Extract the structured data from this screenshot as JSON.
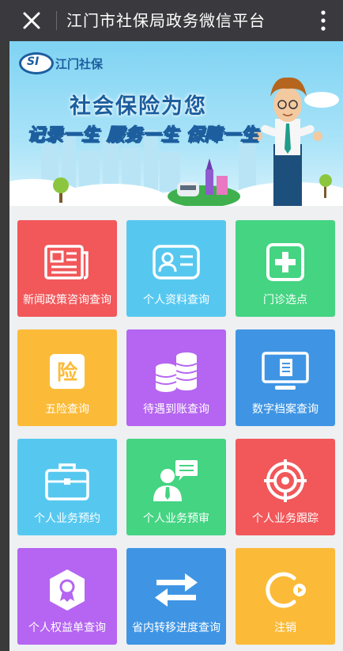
{
  "topbar": {
    "title": "江门市社保局政务微信平台",
    "close_icon": "close-icon",
    "more_icon": "more-vertical-icon"
  },
  "banner": {
    "logo_text": "SI",
    "brand": "江门社保",
    "headline": "社会保险为您",
    "slogan": "记录一生 服务一生 保障一生"
  },
  "tiles": [
    {
      "label": "新闻政策咨询查询",
      "icon": "newspaper-icon",
      "color": "#f2575a"
    },
    {
      "label": "个人资料查询",
      "icon": "id-card-icon",
      "color": "#56c8f0"
    },
    {
      "label": "门诊选点",
      "icon": "medical-plus-icon",
      "color": "#44d482"
    },
    {
      "label": "五险查询",
      "icon": "insurance-icon",
      "color": "#fbbb39"
    },
    {
      "label": "待遇到账查询",
      "icon": "coins-icon",
      "color": "#b565f1"
    },
    {
      "label": "数字档案查询",
      "icon": "monitor-document-icon",
      "color": "#3f95e4"
    },
    {
      "label": "个人业务预约",
      "icon": "briefcase-icon",
      "color": "#56c8f0"
    },
    {
      "label": "个人业务预审",
      "icon": "consultant-icon",
      "color": "#44d482"
    },
    {
      "label": "个人业务跟踪",
      "icon": "target-icon",
      "color": "#f2575a"
    },
    {
      "label": "个人权益单查询",
      "icon": "badge-icon",
      "color": "#b565f1"
    },
    {
      "label": "省内转移进度查询",
      "icon": "transfer-arrows-icon",
      "color": "#3f95e4"
    },
    {
      "label": "注销",
      "icon": "logout-icon",
      "color": "#fbbb39"
    }
  ]
}
